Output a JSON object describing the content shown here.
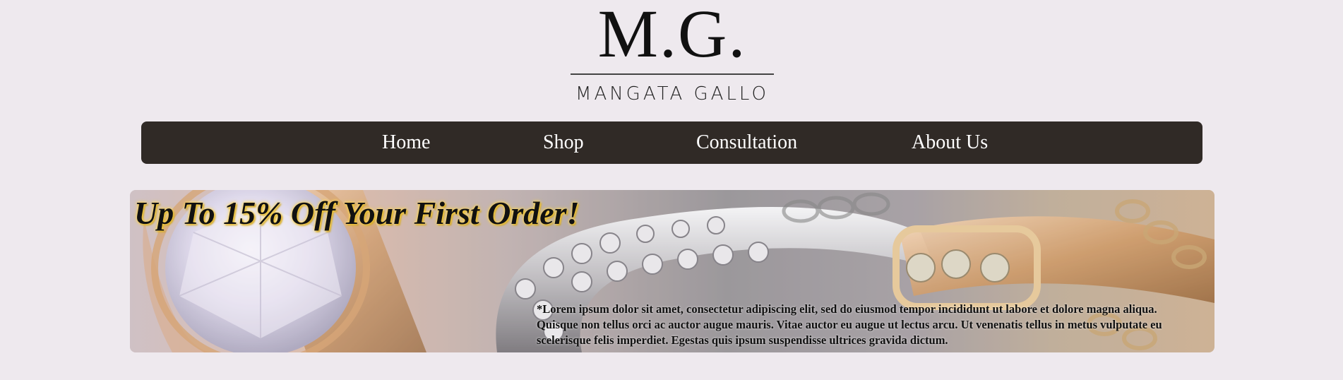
{
  "logo": {
    "mark": "M.G.",
    "name": "MANGATA GALLO"
  },
  "nav": {
    "items": [
      {
        "label": "Home"
      },
      {
        "label": "Shop"
      },
      {
        "label": "Consultation"
      },
      {
        "label": "About Us"
      }
    ]
  },
  "banner": {
    "title": "Up To 15% Off Your First Order!",
    "disclaimer": "*Lorem ipsum dolor sit amet, consectetur adipiscing elit, sed do eiusmod tempor incididunt ut labore et dolore magna aliqua. Quisque non tellus orci ac auctor augue mauris. Vitae auctor eu augue ut lectus arcu. Ut venenatis tellus in metus vulputate eu scelerisque felis imperdiet. Egestas quis ipsum suspendisse ultrices gravida dictum."
  },
  "colors": {
    "page_background": "#eee9ee",
    "nav_background": "#302a26",
    "nav_text": "#ffffff",
    "title_glow": "#ffd23a"
  }
}
